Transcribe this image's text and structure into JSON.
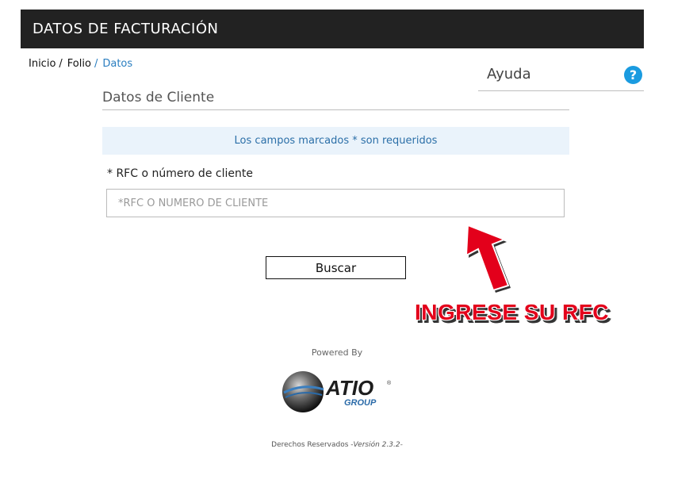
{
  "header": {
    "title": "DATOS DE FACTURACIÓN"
  },
  "breadcrumb": {
    "items": [
      {
        "label": "Inicio"
      },
      {
        "label": "Folio"
      },
      {
        "label": "Datos"
      }
    ],
    "separator": "/"
  },
  "help": {
    "label": "Ayuda",
    "icon": "question-icon",
    "icon_glyph": "?"
  },
  "section": {
    "title": "Datos de Cliente"
  },
  "notice": {
    "text": "Los campos marcados * son requeridos"
  },
  "form": {
    "rfc_label": "* RFC o número de cliente",
    "rfc_placeholder": "*RFC Ó NÚMERO DE CLIENTE",
    "rfc_value": "",
    "search_label": "Buscar"
  },
  "callout": {
    "text": "INGRESE SU RFC",
    "color": "#e3001b"
  },
  "powered_by": {
    "text": "Powered By"
  },
  "logo": {
    "brand": "ATIO",
    "sub": "GROUP",
    "mark": "®"
  },
  "footer": {
    "rights": "Derechos Reservados -",
    "version": "Versión 2.3.2-"
  },
  "colors": {
    "header_bg": "#222222",
    "accent": "#1a9be0",
    "link": "#2a7ec0",
    "notice_bg": "#eaf3fb"
  }
}
